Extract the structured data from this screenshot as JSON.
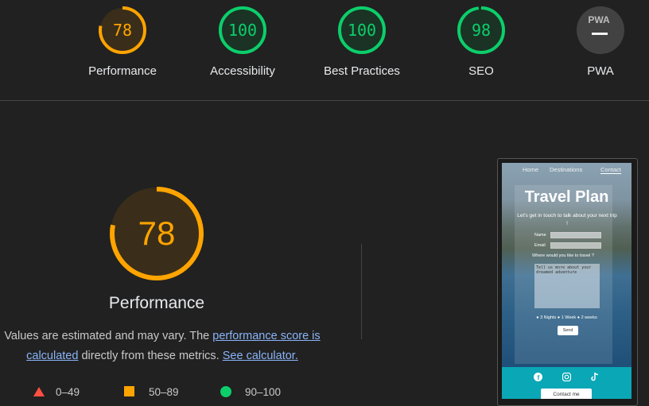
{
  "gauges": [
    {
      "value": "78",
      "label": "Performance",
      "score": 78,
      "color": "#ffa400"
    },
    {
      "value": "100",
      "label": "Accessibility",
      "score": 100,
      "color": "#0cce6b"
    },
    {
      "value": "100",
      "label": "Best Practices",
      "score": 100,
      "color": "#0cce6b"
    },
    {
      "value": "98",
      "label": "SEO",
      "score": 98,
      "color": "#0cce6b"
    },
    {
      "value": "PWA",
      "label": "PWA",
      "score": null,
      "color": "#9e9e9e"
    }
  ],
  "performance": {
    "score": "78",
    "title": "Performance",
    "note_prefix": "Values are estimated and may vary. The ",
    "note_link1": "performance score is calculated",
    "note_middle": " directly from these metrics. ",
    "note_link2": "See calculator."
  },
  "legend": [
    {
      "range": "0–49",
      "color": "#ff4e42",
      "shape": "triangle"
    },
    {
      "range": "50–89",
      "color": "#ffa400",
      "shape": "square"
    },
    {
      "range": "90–100",
      "color": "#0cce6b",
      "shape": "circle"
    }
  ],
  "screenshot": {
    "nav": [
      "Home",
      "Destinations",
      "Contact"
    ],
    "title": "Travel Plan",
    "subtitle": "Let's get in touch to talk about your next trip !",
    "name_label": "Name",
    "email_label": "Email",
    "question": "Where would you like to travel ?",
    "textarea_text": "Tell us more about your dreamed adventure",
    "radio_options": "● 3 Nights ● 1 Week ● 2 weeks",
    "send_label": "Send",
    "social_icons": [
      "facebook-icon",
      "instagram-icon",
      "tiktok-icon"
    ],
    "contact_button": "Contact me"
  }
}
